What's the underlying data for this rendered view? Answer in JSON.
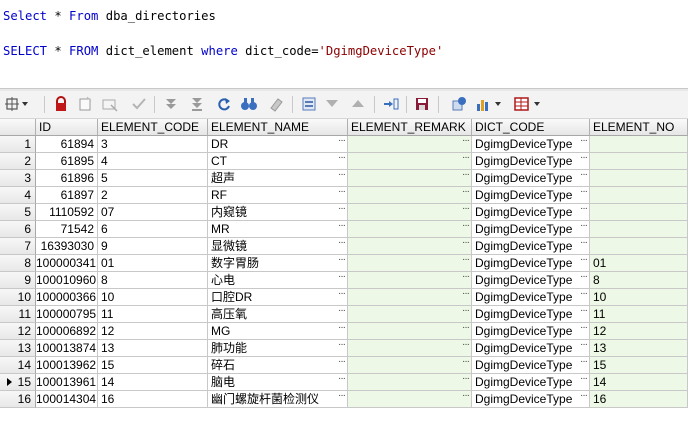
{
  "editor": {
    "line1": {
      "kw1": "Select",
      "rest1": " * ",
      "kw2": "From",
      "rest2": " dba_directories"
    },
    "line2": {
      "kw1": "SELECT",
      "rest1": " * ",
      "kw2": "FROM",
      "rest2": " dict_element ",
      "kw3": "where",
      "rest3": " dict_code=",
      "str": "'DgimgDeviceType'"
    }
  },
  "toolbar": {
    "icons": [
      "grid-icon",
      "lock-icon",
      "new-record-icon",
      "delete-record-icon",
      "post-icon",
      "first-record-icon",
      "last-record-icon",
      "refresh-icon",
      "find-icon",
      "clear-icon",
      "query-icon",
      "filter-icon",
      "sort-up-icon",
      "export-icon",
      "save-icon",
      "publish-icon",
      "chart-icon",
      "table-icon"
    ]
  },
  "grid": {
    "columns": [
      "ID",
      "ELEMENT_CODE",
      "ELEMENT_NAME",
      "ELEMENT_REMARK",
      "DICT_CODE",
      "ELEMENT_NO"
    ],
    "ellipsis": "···",
    "current_row": 15,
    "rows": [
      {
        "n": "1",
        "id": "61894",
        "code": "3",
        "name": "DR",
        "remark": "",
        "dict": "DgimgDeviceType",
        "no": ""
      },
      {
        "n": "2",
        "id": "61895",
        "code": "4",
        "name": "CT",
        "remark": "",
        "dict": "DgimgDeviceType",
        "no": ""
      },
      {
        "n": "3",
        "id": "61896",
        "code": "5",
        "name": "超声",
        "remark": "",
        "dict": "DgimgDeviceType",
        "no": ""
      },
      {
        "n": "4",
        "id": "61897",
        "code": "2",
        "name": "RF",
        "remark": "",
        "dict": "DgimgDeviceType",
        "no": ""
      },
      {
        "n": "5",
        "id": "1110592",
        "code": "07",
        "name": "内窥镜",
        "remark": "",
        "dict": "DgimgDeviceType",
        "no": ""
      },
      {
        "n": "6",
        "id": "71542",
        "code": "6",
        "name": "MR",
        "remark": "",
        "dict": "DgimgDeviceType",
        "no": ""
      },
      {
        "n": "7",
        "id": "16393030",
        "code": "9",
        "name": "显微镜",
        "remark": "",
        "dict": "DgimgDeviceType",
        "no": ""
      },
      {
        "n": "8",
        "id": "100000341",
        "code": "01",
        "name": "数字胃肠",
        "remark": "",
        "dict": "DgimgDeviceType",
        "no": "01"
      },
      {
        "n": "9",
        "id": "100010960",
        "code": "8",
        "name": "心电",
        "remark": "",
        "dict": "DgimgDeviceType",
        "no": "8"
      },
      {
        "n": "10",
        "id": "100000366",
        "code": "10",
        "name": "口腔DR",
        "remark": "",
        "dict": "DgimgDeviceType",
        "no": "10"
      },
      {
        "n": "11",
        "id": "100000795",
        "code": "11",
        "name": "高压氧",
        "remark": "",
        "dict": "DgimgDeviceType",
        "no": "11"
      },
      {
        "n": "12",
        "id": "100006892",
        "code": "12",
        "name": "MG",
        "remark": "",
        "dict": "DgimgDeviceType",
        "no": "12"
      },
      {
        "n": "13",
        "id": "100013874",
        "code": "13",
        "name": "肺功能",
        "remark": "",
        "dict": "DgimgDeviceType",
        "no": "13"
      },
      {
        "n": "14",
        "id": "100013962",
        "code": "15",
        "name": "碎石",
        "remark": "",
        "dict": "DgimgDeviceType",
        "no": "15"
      },
      {
        "n": "15",
        "id": "100013961",
        "code": "14",
        "name": "脑电",
        "remark": "",
        "dict": "DgimgDeviceType",
        "no": "14"
      },
      {
        "n": "16",
        "id": "100014304",
        "code": "16",
        "name": "幽门螺旋杆菌检测仪",
        "remark": "",
        "dict": "DgimgDeviceType",
        "no": "16"
      }
    ]
  }
}
